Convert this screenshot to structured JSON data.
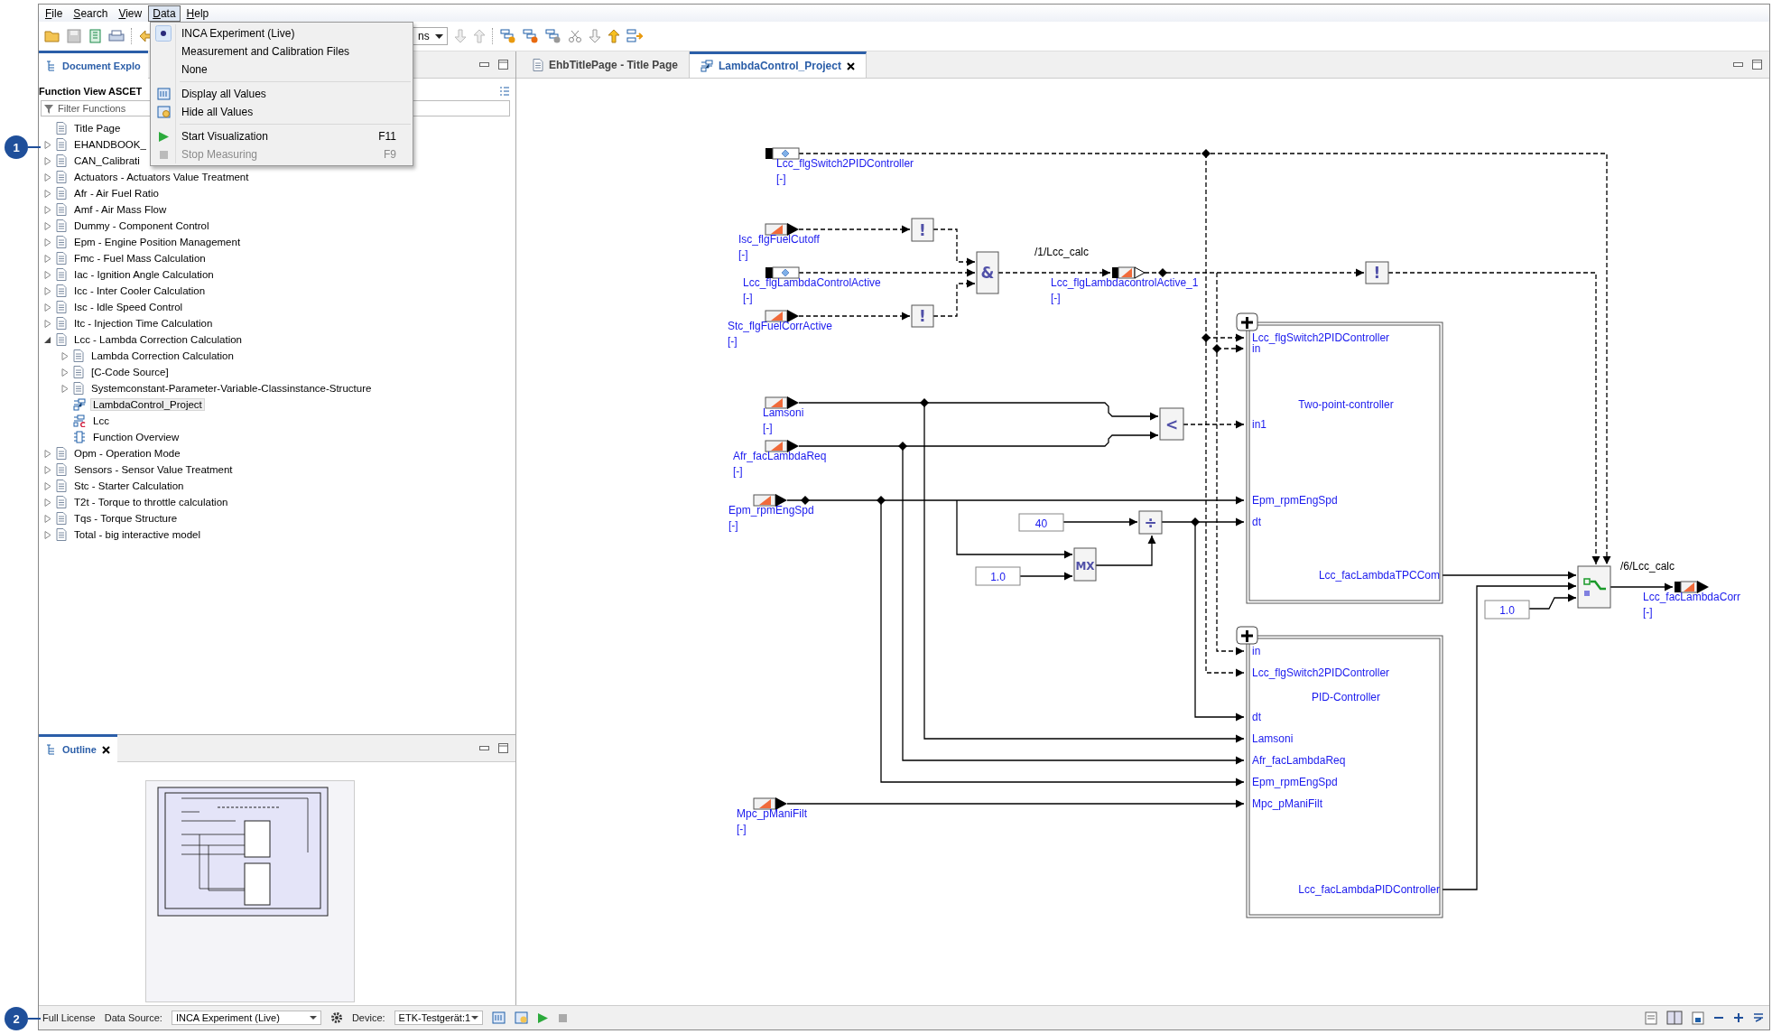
{
  "menu_bar": [
    {
      "label": "File",
      "selected": false
    },
    {
      "label": "Search",
      "selected": false
    },
    {
      "label": "View",
      "selected": false
    },
    {
      "label": "Data",
      "selected": true
    },
    {
      "label": "Help",
      "selected": false
    }
  ],
  "data_menu": {
    "items": [
      {
        "kind": "radio",
        "label": "INCA Experiment (Live)",
        "checked": true
      },
      {
        "kind": "radio",
        "label": "Measurement and Calibration Files",
        "checked": false
      },
      {
        "kind": "radio",
        "label": "None",
        "checked": false
      },
      {
        "kind": "separator"
      },
      {
        "kind": "command",
        "label": "Display all Values",
        "disabled": false
      },
      {
        "kind": "command",
        "label": "Hide all Values",
        "disabled": false
      },
      {
        "kind": "separator"
      },
      {
        "kind": "command",
        "label": "Start Visualization",
        "shortcut": "F11",
        "disabled": false
      },
      {
        "kind": "command",
        "label": "Stop Measuring",
        "shortcut": "F9",
        "disabled": true
      }
    ]
  },
  "toolbar": {
    "combo_text": "ns"
  },
  "explorer": {
    "tab": "Document Explo",
    "heading": "Function View ASCET",
    "filter_placeholder": "Filter Functions",
    "tree": [
      {
        "kind": "document",
        "label": "Title Page",
        "selected": false
      },
      {
        "kind": "document",
        "label": "EHANDBOOK_",
        "expanded": false,
        "selected": false
      },
      {
        "kind": "document",
        "label": "CAN_Calibrati",
        "expanded": false,
        "selected": false
      },
      {
        "kind": "document",
        "label": "Actuators - Actuators Value Treatment",
        "expanded": false,
        "selected": false
      },
      {
        "kind": "document",
        "label": "Afr - Air Fuel Ratio",
        "expanded": false,
        "selected": false
      },
      {
        "kind": "document",
        "label": "Amf - Air Mass Flow",
        "expanded": false,
        "selected": false
      },
      {
        "kind": "document",
        "label": "Dummy - Component Control",
        "expanded": false,
        "selected": false
      },
      {
        "kind": "document",
        "label": "Epm - Engine Position Management",
        "expanded": false,
        "selected": false
      },
      {
        "kind": "document",
        "label": "Fmc - Fuel Mass Calculation",
        "expanded": false,
        "selected": false
      },
      {
        "kind": "document",
        "label": "Iac - Ignition Angle Calculation",
        "expanded": false,
        "selected": false
      },
      {
        "kind": "document",
        "label": "Icc - Inter Cooler Calculation",
        "expanded": false,
        "selected": false
      },
      {
        "kind": "document",
        "label": "Isc - Idle Speed Control",
        "expanded": false,
        "selected": false
      },
      {
        "kind": "document",
        "label": "Itc - Injection Time Calculation",
        "expanded": false,
        "selected": false
      },
      {
        "kind": "document",
        "label": "Lcc - Lambda Correction Calculation",
        "expanded": true,
        "selected": false,
        "children": [
          {
            "kind": "document",
            "label": "Lambda Correction Calculation",
            "expanded": false,
            "selected": false
          },
          {
            "kind": "document",
            "label": "[C-Code Source]",
            "expanded": false,
            "selected": false
          },
          {
            "kind": "document",
            "label": "Systemconstant-Parameter-Variable-Classinstance-Structure",
            "expanded": false,
            "selected": false
          },
          {
            "kind": "diagram",
            "label": "LambdaControl_Project",
            "selected": true
          },
          {
            "kind": "class",
            "label": "Lcc",
            "selected": false
          },
          {
            "kind": "overview",
            "label": "Function Overview",
            "selected": false
          }
        ]
      },
      {
        "kind": "document",
        "label": "Opm - Operation Mode",
        "expanded": false,
        "selected": false
      },
      {
        "kind": "document",
        "label": "Sensors - Sensor Value Treatment",
        "expanded": false,
        "selected": false
      },
      {
        "kind": "document",
        "label": "Stc - Starter Calculation",
        "expanded": false,
        "selected": false
      },
      {
        "kind": "document",
        "label": "T2t - Torque to throttle calculation",
        "expanded": false,
        "selected": false
      },
      {
        "kind": "document",
        "label": "Tqs - Torque Structure",
        "expanded": false,
        "selected": false
      },
      {
        "kind": "document",
        "label": "Total - big interactive model",
        "expanded": false,
        "selected": false
      }
    ]
  },
  "outline": {
    "tab": "Outline"
  },
  "editor": {
    "tabs": [
      {
        "label": "EhbTitlePage - Title Page",
        "selected": false
      },
      {
        "label": "LambdaControl_Project",
        "selected": true
      }
    ],
    "diagram": {
      "inputs": [
        {
          "kind": "parameter",
          "name": "Lcc_flgSwitch2PIDController",
          "unit": "[-]"
        },
        {
          "kind": "message",
          "name": "Isc_flgFuelCutoff",
          "unit": "[-]"
        },
        {
          "kind": "parameter",
          "name": "Lcc_flgLambdaControlActive",
          "unit": "[-]"
        },
        {
          "kind": "message",
          "name": "Stc_flgFuelCorrActive",
          "unit": "[-]"
        },
        {
          "kind": "message",
          "name": "Lamsoni",
          "unit": "[-]"
        },
        {
          "kind": "message",
          "name": "Afr_facLambdaReq",
          "unit": "[-]"
        },
        {
          "kind": "message",
          "name": "Epm_rpmEngSpd",
          "unit": "[-]"
        },
        {
          "kind": "message",
          "name": "Mpc_pManiFilt",
          "unit": "[-]"
        }
      ],
      "outputs": [
        {
          "kind": "boolean",
          "name": "Lcc_flgLambdacontrolActive_1",
          "unit": "[-]"
        },
        {
          "kind": "continuous",
          "name": "Lcc_facLambdaCorr",
          "unit": "[-]"
        }
      ],
      "process_labels": [
        "/1/Lcc_calc",
        "/6/Lcc_calc"
      ],
      "operators": [
        {
          "kind": "not",
          "symbol": "!"
        },
        {
          "kind": "and",
          "symbol": "&"
        },
        {
          "kind": "not",
          "symbol": "!"
        },
        {
          "kind": "not",
          "symbol": "!"
        },
        {
          "kind": "compare",
          "symbol": "<"
        },
        {
          "kind": "divide",
          "symbol": "÷"
        },
        {
          "kind": "max",
          "symbol": "MX"
        },
        {
          "kind": "switch"
        }
      ],
      "constants": [
        "40",
        "1.0",
        "1.0"
      ],
      "components": [
        {
          "title": "Two-point-controller",
          "ports": [
            "Lcc_flgSwitch2PIDController",
            "in",
            "in1",
            "Epm_rpmEngSpd",
            "dt"
          ],
          "output": "Lcc_facLambdaTPCCom"
        },
        {
          "title": "PID-Controller",
          "ports": [
            "in",
            "Lcc_flgSwitch2PIDController",
            "dt",
            "Lamsoni",
            "Afr_facLambdaReq",
            "Epm_rpmEngSpd",
            "Mpc_pManiFilt"
          ],
          "output": "Lcc_facLambdaPIDController"
        }
      ]
    }
  },
  "status_bar": {
    "license": "Full License",
    "data_source_label": "Data Source:",
    "data_source": "INCA Experiment (Live)",
    "device_label": "Device:",
    "device": "ETK-Testgerät:1"
  },
  "callouts": [
    "1",
    "2"
  ]
}
